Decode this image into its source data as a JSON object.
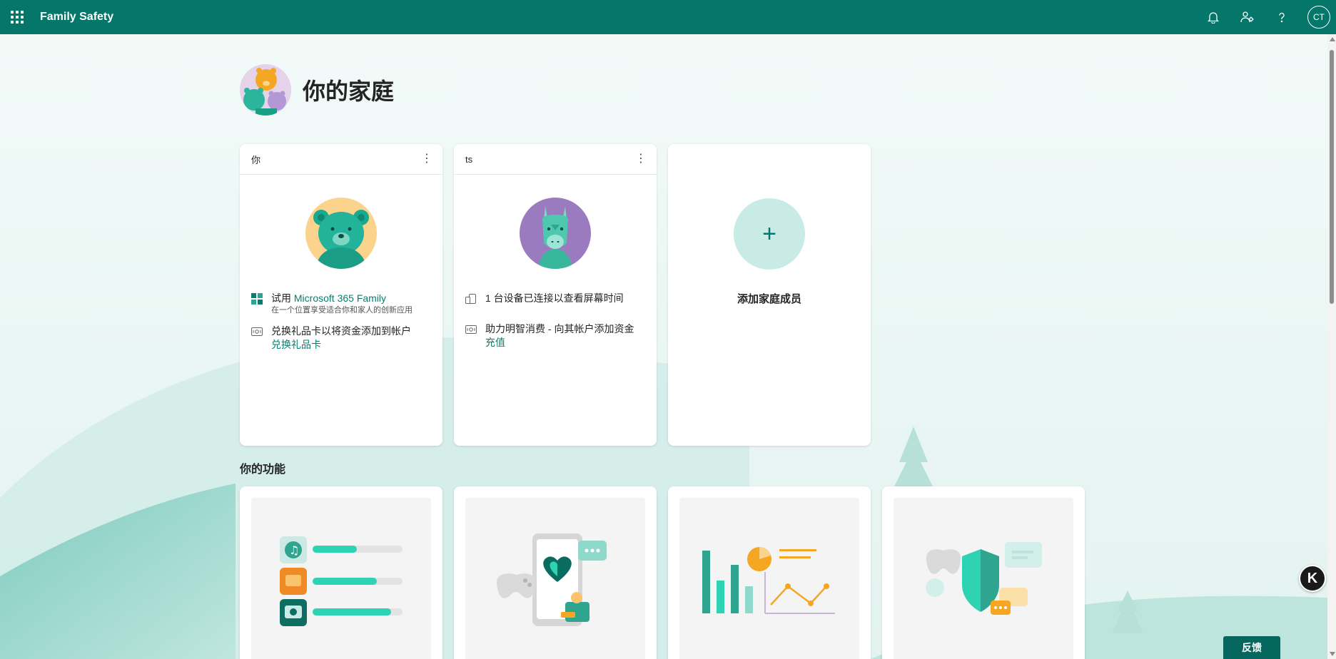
{
  "app": {
    "title": "Family Safety",
    "user_initials": "CT"
  },
  "icons": {
    "waffle": "app-launcher-icon",
    "bell": "notification-bell-icon",
    "family": "family-settings-icon",
    "help": "help-icon"
  },
  "family": {
    "title": "你的家庭"
  },
  "members": [
    {
      "name": "你",
      "row1": {
        "prefix": "试用 ",
        "link": "Microsoft 365 Family",
        "sub": "在一个位置享受适合你和家人的创新应用"
      },
      "row2": {
        "text": "兑换礼品卡以将资金添加到帐户",
        "link": "兑换礼品卡"
      }
    },
    {
      "name": "ts",
      "row1": {
        "text": "1 台设备已连接以查看屏幕时间"
      },
      "row2": {
        "text": "助力明智消费 - 向其帐户添加资金",
        "link": "充值"
      }
    }
  ],
  "add_member": {
    "plus": "+",
    "label": "添加家庭成员"
  },
  "features": {
    "title": "你的功能"
  },
  "feedback": "反馈",
  "badge": "K",
  "colors": {
    "brand": "#04766a",
    "link": "#0a7c6f",
    "accent": "#2fc9b2"
  }
}
